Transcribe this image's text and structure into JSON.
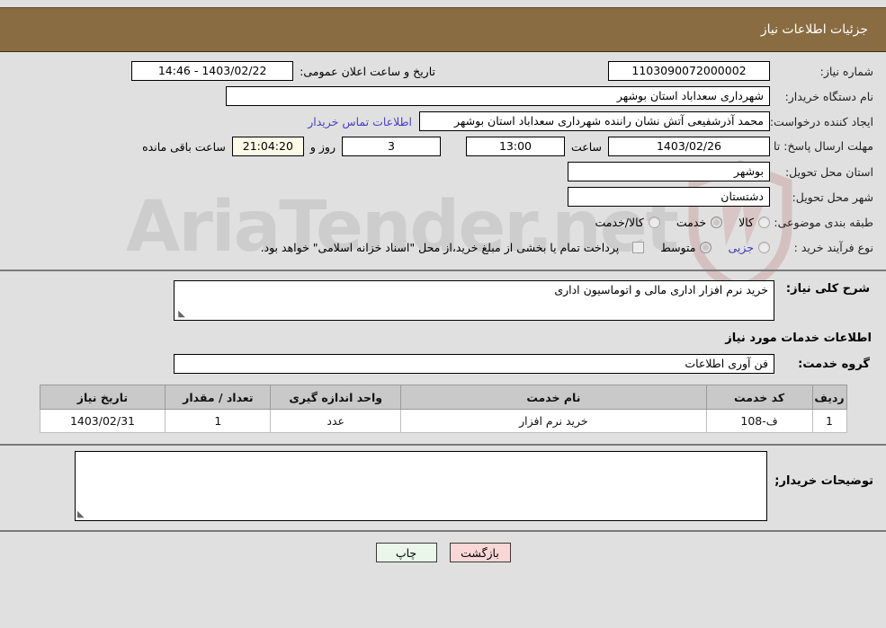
{
  "header": {
    "title": "جزئیات اطلاعات نیاز",
    "accent_color": "#8a6c42"
  },
  "watermark": {
    "text": "AriaTender.net"
  },
  "fields": {
    "need_number_label": "شماره نیاز:",
    "need_number_value": "1103090072000002",
    "announce_datetime_label": "تاریخ و ساعت اعلان عمومی:",
    "announce_datetime_value": "1403/02/22 - 14:46",
    "buyer_org_label": "نام دستگاه خریدار:",
    "buyer_org_value": "شهرداری سعداباد استان بوشهر",
    "creator_label": "ایجاد کننده درخواست:",
    "creator_value": "محمد آذرشفیعی آتش نشان راننده شهرداری سعداباد استان بوشهر",
    "contact_link": "اطلاعات تماس خریدار",
    "deadline_label": "مهلت ارسال پاسخ: تا تاریخ:",
    "deadline_date": "1403/02/26",
    "hour_label": "ساعت",
    "hour_value": "13:00",
    "days_value": "3",
    "days_suffix": "روز و",
    "remaining_value": "21:04:20",
    "remaining_suffix": "ساعت باقی مانده",
    "province_label": "استان محل تحویل:",
    "province_value": "بوشهر",
    "city_label": "شهر محل تحویل:",
    "city_value": "دشتستان",
    "category_label": "طبقه بندی موضوعی:",
    "process_label": "نوع فرآیند خرید :",
    "treasury_note": "پرداخت تمام یا بخشی از مبلغ خرید،از محل \"اسناد خزانه اسلامی\" خواهد بود."
  },
  "category_options": [
    {
      "label": "کالا",
      "selected": false
    },
    {
      "label": "خدمت",
      "selected": true
    },
    {
      "label": "کالا/خدمت",
      "selected": false
    }
  ],
  "process_options": [
    {
      "label": "جزیی",
      "selected": false
    },
    {
      "label": "متوسط",
      "selected": true
    }
  ],
  "description": {
    "label": "شرح کلی نیاز:",
    "value": "خرید نرم افزار اداری مالی و اتوماسیون اداری"
  },
  "services_section": {
    "title": "اطلاعات خدمات مورد نیاز",
    "group_label": "گروه خدمت:",
    "group_value": "فن آوری اطلاعات"
  },
  "table": {
    "headers": {
      "row": "ردیف",
      "code": "کد خدمت",
      "name": "نام خدمت",
      "unit": "واحد اندازه گیری",
      "qty": "تعداد / مقدار",
      "date": "تاریخ نیاز"
    },
    "rows": [
      {
        "row": "1",
        "code": "ف-108",
        "name": "خرید نرم افزار",
        "unit": "عدد",
        "qty": "1",
        "date": "1403/02/31"
      }
    ]
  },
  "remarks": {
    "label": "توضیحات خریدار;",
    "value": ""
  },
  "footer": {
    "print_label": "چاپ",
    "back_label": "بازگشت",
    "print_color": "#eaf6ea",
    "back_color": "#f9d7d7"
  }
}
